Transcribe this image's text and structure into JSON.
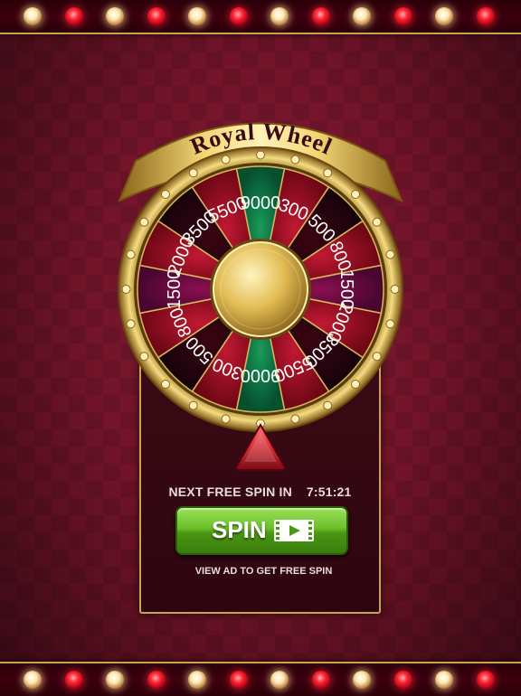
{
  "title": "Royal Wheel",
  "wheel": {
    "segments": [
      {
        "value": "9000",
        "color": "green"
      },
      {
        "value": "300",
        "color": "red"
      },
      {
        "value": "500",
        "color": "dark"
      },
      {
        "value": "800",
        "color": "red"
      },
      {
        "value": "1500",
        "color": "purple"
      },
      {
        "value": "2000",
        "color": "red"
      },
      {
        "value": "3500",
        "color": "dark"
      },
      {
        "value": "5500",
        "color": "red"
      },
      {
        "value": "9000",
        "color": "green"
      },
      {
        "value": "300",
        "color": "red"
      },
      {
        "value": "500",
        "color": "dark"
      },
      {
        "value": "800",
        "color": "red"
      },
      {
        "value": "1500",
        "color": "purple"
      },
      {
        "value": "2000",
        "color": "red"
      },
      {
        "value": "3500",
        "color": "dark"
      },
      {
        "value": "5500",
        "color": "red"
      }
    ]
  },
  "next_free_spin_label": "NEXT FREE SPIN IN",
  "next_free_spin_time": "7:51:21",
  "spin_button_label": "SPIN",
  "video_icon": "video-play-icon",
  "view_ad_text": "VIEW AD TO GET  FREE SPIN",
  "colors": {
    "gold": "#c9a44a",
    "green_button": "#6cbf2a",
    "pointer_red": "#d4303a"
  }
}
